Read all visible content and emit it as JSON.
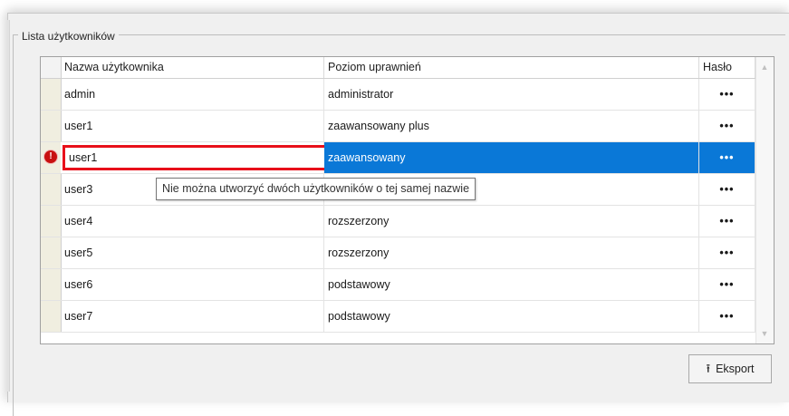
{
  "groupbox": {
    "title": "Lista użytkowników"
  },
  "grid": {
    "columns": [
      "Nazwa użytkownika",
      "Poziom uprawnień",
      "Hasło"
    ],
    "rows": [
      {
        "name": "admin",
        "level": "administrator",
        "password": "•••"
      },
      {
        "name": "user1",
        "level": "zaawansowany plus",
        "password": "•••"
      },
      {
        "name": "user1",
        "level": "zaawansowany",
        "password": "•••"
      },
      {
        "name": "user3",
        "level": "",
        "password": "•••"
      },
      {
        "name": "user4",
        "level": "rozszerzony",
        "password": "•••"
      },
      {
        "name": "user5",
        "level": "rozszerzony",
        "password": "•••"
      },
      {
        "name": "user6",
        "level": "podstawowy",
        "password": "•••"
      },
      {
        "name": "user7",
        "level": "podstawowy",
        "password": "•••"
      }
    ],
    "error_icon": "!",
    "tooltip": "Nie można utworzyć dwóch użytkowników o tej samej nazwie"
  },
  "export_button": {
    "label": "Eksport",
    "icon": "export-icon"
  },
  "colors": {
    "selection": "#0a78d7",
    "error_border": "#e8101a",
    "error_icon": "#c81010"
  }
}
